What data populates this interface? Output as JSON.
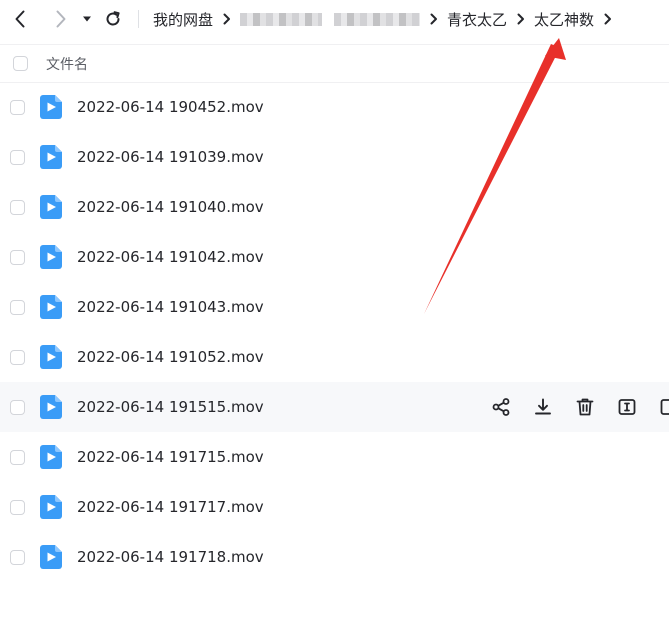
{
  "breadcrumb": {
    "root": "我的网盘",
    "level3": "青衣太乙",
    "current": "太乙神数"
  },
  "header": {
    "name_col": "文件名"
  },
  "files": [
    "2022-06-14 190452.mov",
    "2022-06-14 191039.mov",
    "2022-06-14 191040.mov",
    "2022-06-14 191042.mov",
    "2022-06-14 191043.mov",
    "2022-06-14 191052.mov",
    "2022-06-14 191515.mov",
    "2022-06-14 191715.mov",
    "2022-06-14 191717.mov",
    "2022-06-14 191718.mov"
  ],
  "hovered_row": 7,
  "colors": {
    "file_icon": "#3a9cf7",
    "annotation_arrow": "#e8302a",
    "row_hover_bg": "#f7f8fa"
  },
  "icons": {
    "back": "chevron-left-icon",
    "forward": "chevron-right-icon",
    "history": "caret-down-icon",
    "refresh": "refresh-icon",
    "separator": "chevron-right-icon",
    "file": "video-file-icon",
    "share": "share-icon",
    "download": "download-icon",
    "delete": "trash-icon",
    "rename": "rename-icon",
    "more": "more-icon"
  }
}
